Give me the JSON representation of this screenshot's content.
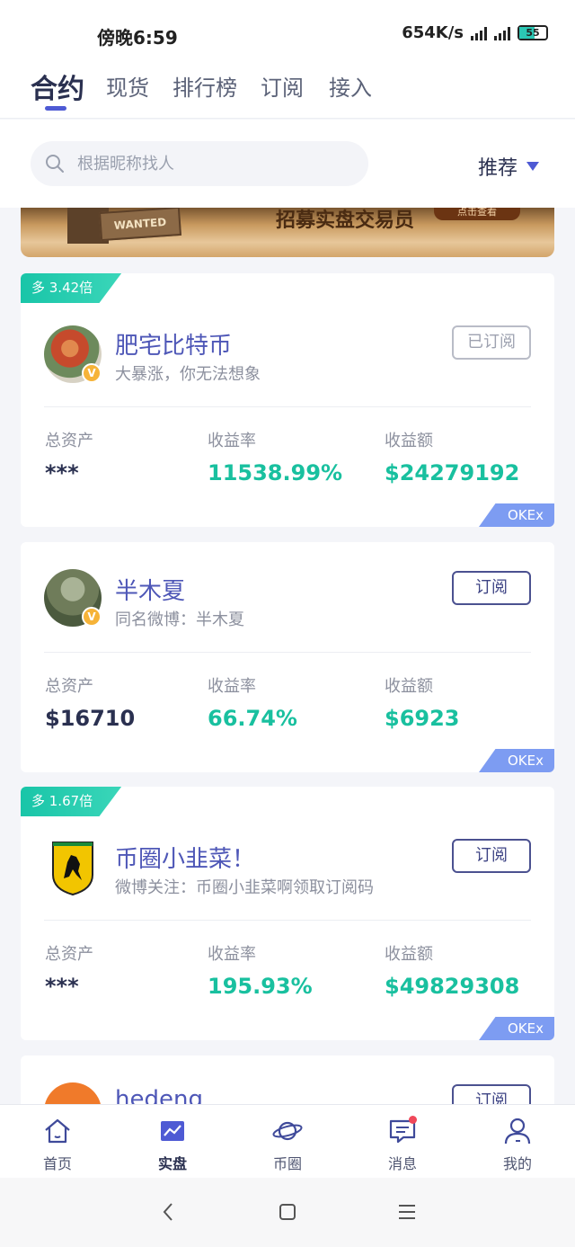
{
  "status_bar": {
    "time": "傍晚6:59",
    "speed": "654K/s",
    "battery": "55"
  },
  "tabs": [
    {
      "label": "合约"
    },
    {
      "label": "现货"
    },
    {
      "label": "排行榜"
    },
    {
      "label": "订阅"
    },
    {
      "label": "接入"
    }
  ],
  "search": {
    "placeholder": "根据昵称找人"
  },
  "sort": {
    "label": "推荐"
  },
  "banner": {
    "wanted_text": "WANTED",
    "text": "招募实盘交易员",
    "button": "点击查看"
  },
  "stat_labels": {
    "assets": "总资产",
    "rate": "收益率",
    "amount": "收益额"
  },
  "cards": [
    {
      "tag": "多 3.42倍",
      "name": "肥宅比特币",
      "desc": "大暴涨，你无法想象",
      "button": "已订阅",
      "assets": "***",
      "rate": "11538.99%",
      "amount": "$24279192",
      "exchange": "OKEx"
    },
    {
      "tag": "",
      "name": "半木夏",
      "desc": "同名微博：半木夏",
      "button": "订阅",
      "assets": "$16710",
      "rate": "66.74%",
      "amount": "$6923",
      "exchange": "OKEx"
    },
    {
      "tag": "多 1.67倍",
      "name": "币圈小韭菜！",
      "desc": "微博关注：币圈小韭菜啊领取订阅码",
      "button": "订阅",
      "assets": "***",
      "rate": "195.93%",
      "amount": "$49829308",
      "exchange": "OKEx"
    },
    {
      "tag": "",
      "name": "hedeng",
      "desc": "",
      "button": "订阅",
      "assets": "",
      "rate": "",
      "amount": "",
      "exchange": ""
    }
  ],
  "vbadge": "V",
  "bottom_nav": [
    {
      "label": "首页",
      "icon": "home-icon"
    },
    {
      "label": "实盘",
      "icon": "chart-icon"
    },
    {
      "label": "币圈",
      "icon": "planet-icon"
    },
    {
      "label": "消息",
      "icon": "message-icon"
    },
    {
      "label": "我的",
      "icon": "user-icon"
    }
  ],
  "colors": {
    "accent": "#4e5ad4",
    "green": "#19c09f",
    "exchange_tag": "#7d9cf2",
    "notify": "#f0485a"
  }
}
